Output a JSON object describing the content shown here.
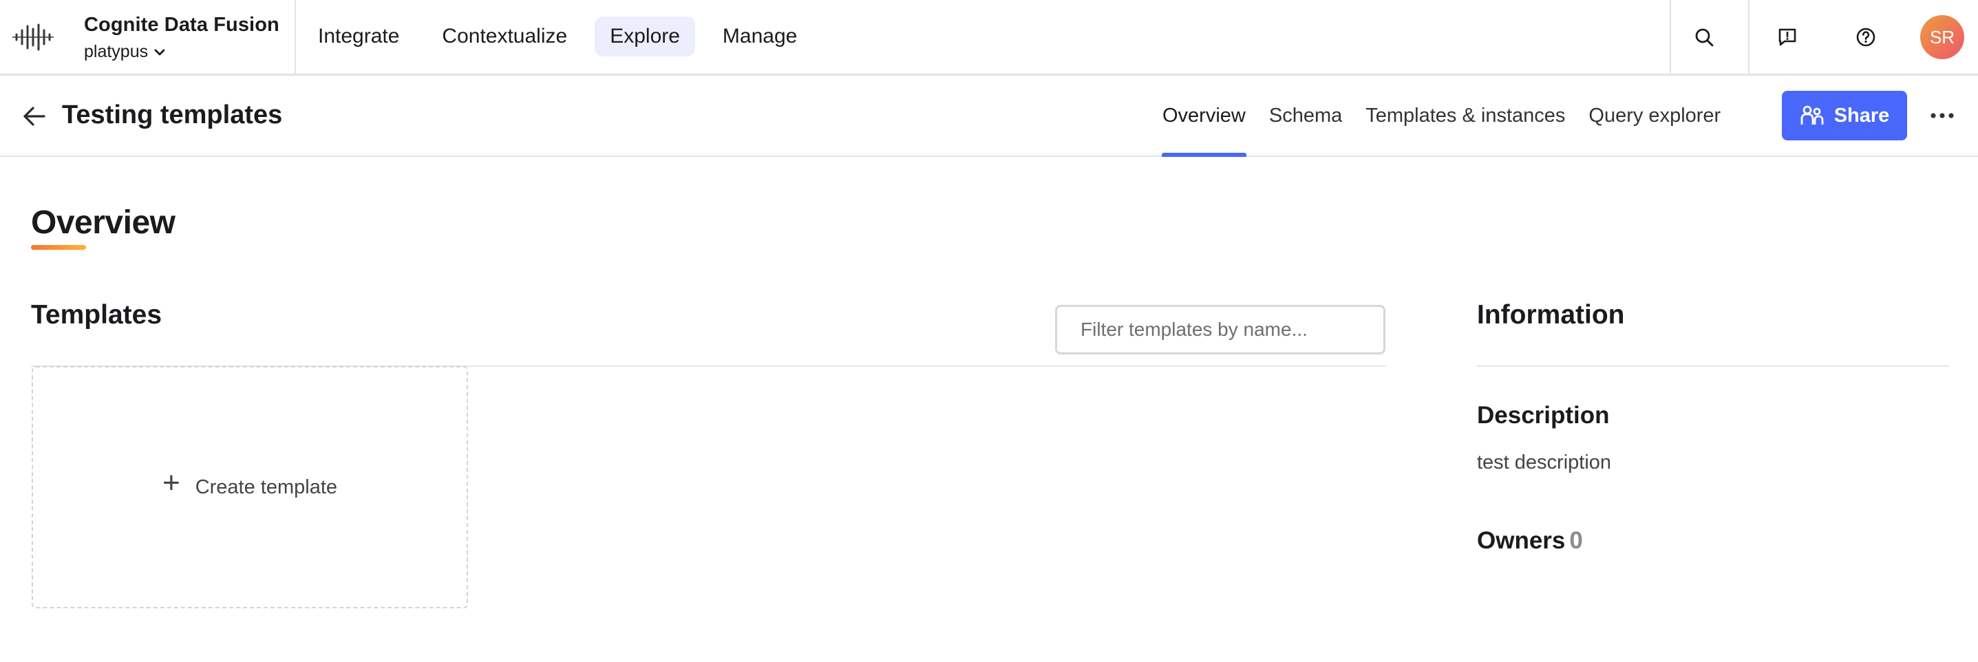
{
  "app": {
    "title": "Cognite Data Fusion",
    "project": "platypus",
    "logo_icon": "cognite-logo-icon"
  },
  "main_nav": {
    "items": [
      {
        "label": "Integrate",
        "active": false
      },
      {
        "label": "Contextualize",
        "active": false
      },
      {
        "label": "Explore",
        "active": true
      },
      {
        "label": "Manage",
        "active": false
      }
    ]
  },
  "top_actions": {
    "search_icon": "search-icon",
    "feedback_icon": "feedback-icon",
    "help_icon": "help-icon",
    "avatar_initials": "SR"
  },
  "subheader": {
    "back_icon": "arrow-left-icon",
    "title": "Testing templates",
    "tabs": [
      {
        "label": "Overview",
        "active": true
      },
      {
        "label": "Schema",
        "active": false
      },
      {
        "label": "Templates & instances",
        "active": false
      },
      {
        "label": "Query explorer",
        "active": false
      }
    ],
    "share_label": "Share",
    "more_icon": "more-horizontal-icon"
  },
  "overview": {
    "title": "Overview"
  },
  "templates": {
    "title": "Templates",
    "filter_placeholder": "Filter templates by name...",
    "filter_value": "",
    "create_label": "Create template"
  },
  "information": {
    "title": "Information",
    "description_title": "Description",
    "description_text": "test description",
    "owners_title": "Owners",
    "owners_count": "0"
  },
  "colors": {
    "primary": "#4a67fb",
    "nav_active_bg": "#eceefd",
    "accent_underline_start": "#f4792b",
    "accent_underline_end": "#fbb13c",
    "avatar_start": "#f09a3e",
    "avatar_end": "#ea5a6c"
  }
}
